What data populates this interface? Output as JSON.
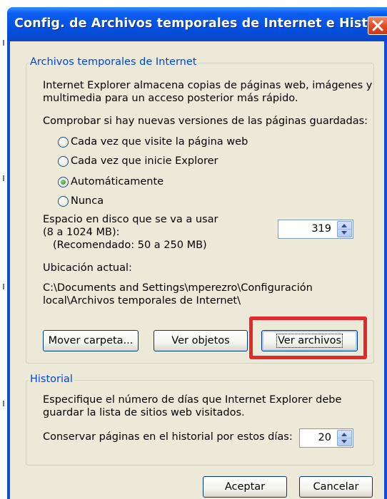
{
  "window": {
    "title": "Config. de Archivos temporales de Internet e Historial"
  },
  "temp_files": {
    "legend": "Archivos temporales de Internet",
    "description_line1": "Internet Explorer almacena copias de páginas web, imágenes y",
    "description_line2": "multimedia para un acceso posterior más rápido.",
    "check_label": "Comprobar si hay nuevas versiones de las páginas guardadas:",
    "options": [
      {
        "label": "Cada vez que visite la página web",
        "checked": false
      },
      {
        "label": "Cada vez que inicie Explorer",
        "checked": false
      },
      {
        "label": "Automáticamente",
        "checked": true
      },
      {
        "label": "Nunca",
        "checked": false
      }
    ],
    "disk_label_line1": "Espacio en disco que se va a usar",
    "disk_label_line2": "(8 a 1024 MB):",
    "disk_recommended": "(Recomendado: 50 a 250 MB)",
    "disk_value": "319",
    "location_label": "Ubicación actual:",
    "location_line1": "C:\\Documents and Settings\\mperezro\\Configuración",
    "location_line2": "local\\Archivos temporales de Internet\\",
    "buttons": {
      "move_folder": "Mover carpeta...",
      "view_objects": "Ver objetos",
      "view_files": "Ver archivos"
    }
  },
  "history": {
    "legend": "Historial",
    "description_line1": "Especifique el número de días que Internet Explorer debe",
    "description_line2": "guardar la lista de sitios web visitados.",
    "days_label": "Conservar páginas en el historial por estos días:",
    "days_value": "20"
  },
  "footer": {
    "ok": "Aceptar",
    "cancel": "Cancelar"
  },
  "colors": {
    "titlebar": "#0550e0",
    "client": "#ece9d8",
    "legend_text": "#0046d5",
    "highlight": "#e32a2a"
  },
  "icons": {
    "close": "close-icon",
    "spin_up": "arrow-up-icon",
    "spin_down": "arrow-down-icon"
  }
}
